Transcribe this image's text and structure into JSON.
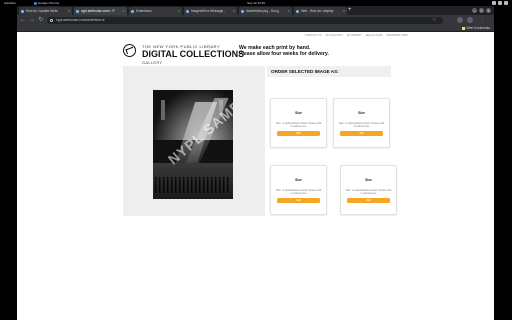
{
  "system": {
    "activities": "Activities",
    "app_name": "Google Chrome",
    "clock": "Sep 13 10:45"
  },
  "browser": {
    "tabs": [
      {
        "label": "How do I update Node"
      },
      {
        "label": "nypl.artehouse.com/ - P"
      },
      {
        "label": "Extensions"
      },
      {
        "label": "Images/Error Message -"
      },
      {
        "label": "doubleclick.png - Goog"
      },
      {
        "label": "html - How do I display"
      }
    ],
    "new_tab_glyph": "+",
    "address": "nypl.artehouse.com/orderitem.cf",
    "other_bookmarks": "Other bookmarks"
  },
  "page": {
    "logo_line1": "THE NEW YORK PUBLIC LIBRARY",
    "logo_title": "DIGITAL COLLECTIONS",
    "logo_sub": "GALLERY",
    "message_line1": "We make each print by hand.",
    "message_line2": "Please allow four weeks for delivery.",
    "nav_links": [
      "CONTACT US",
      "MY ACCOUNT",
      "MY BASKET",
      "HELP & FAQS",
      "SHOPPING CART"
    ],
    "photo_watermark": "NYPL SAMPLE",
    "order_heading": "ORDER SELECTED IMAGE AS:",
    "cards": [
      {
        "title": "Size",
        "desc": "Size: no options/frame shown. Please click to options here",
        "button": "GO"
      },
      {
        "title": "Size",
        "desc": "Size: no options/frame shown. Please click to options here",
        "button": "GO"
      },
      {
        "title": "Size",
        "desc": "Size: no options/frame shown. Please click to options here",
        "button": "GO"
      },
      {
        "title": "Size",
        "desc": "Size: no options/frame shown. Please click to options here",
        "button": "GO"
      }
    ]
  },
  "colors": {
    "accent_button": "#f5a623",
    "panel_grey": "#eeeeee"
  }
}
